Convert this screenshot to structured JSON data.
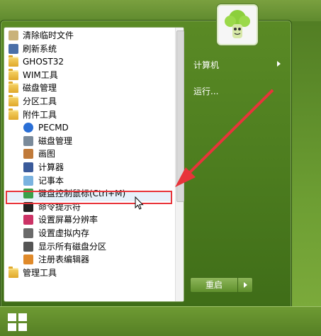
{
  "left_menu": {
    "items": [
      {
        "label": "清除临时文件",
        "icon": "broom-icon",
        "sub": false
      },
      {
        "label": "刷新系统",
        "icon": "monitor-icon",
        "sub": false
      },
      {
        "label": "GHOST32",
        "icon": "folder-icon",
        "sub": false
      },
      {
        "label": "WIM工具",
        "icon": "folder-icon",
        "sub": false
      },
      {
        "label": "磁盘管理",
        "icon": "folder-icon",
        "sub": false
      },
      {
        "label": "分区工具",
        "icon": "folder-icon",
        "sub": false
      },
      {
        "label": "附件工具",
        "icon": "folder-icon",
        "sub": false
      },
      {
        "label": "PECMD",
        "icon": "help-icon",
        "sub": true
      },
      {
        "label": "磁盘管理",
        "icon": "disk-icon",
        "sub": true
      },
      {
        "label": "画图",
        "icon": "paint-icon",
        "sub": true
      },
      {
        "label": "计算器",
        "icon": "calculator-icon",
        "sub": true
      },
      {
        "label": "记事本",
        "icon": "notepad-icon",
        "sub": true
      },
      {
        "label": "键盘控制鼠标(Ctrl+M)",
        "icon": "keyboard-mouse-icon",
        "sub": true
      },
      {
        "label": "命令提示符",
        "icon": "cmd-icon",
        "sub": true
      },
      {
        "label": "设置屏幕分辨率",
        "icon": "display-icon",
        "sub": true
      },
      {
        "label": "设置虚拟内存",
        "icon": "gear-icon",
        "sub": true
      },
      {
        "label": "显示所有磁盘分区",
        "icon": "drive-icon",
        "sub": true
      },
      {
        "label": "注册表编辑器",
        "icon": "registry-icon",
        "sub": true
      },
      {
        "label": "管理工具",
        "icon": "folder-icon",
        "sub": false
      }
    ]
  },
  "right_menu": {
    "computer_label": "计算机",
    "run_label": "运行...",
    "restart_label": "重启"
  },
  "colors": {
    "highlight": "#e8343a",
    "arrow": "#e8343a"
  }
}
